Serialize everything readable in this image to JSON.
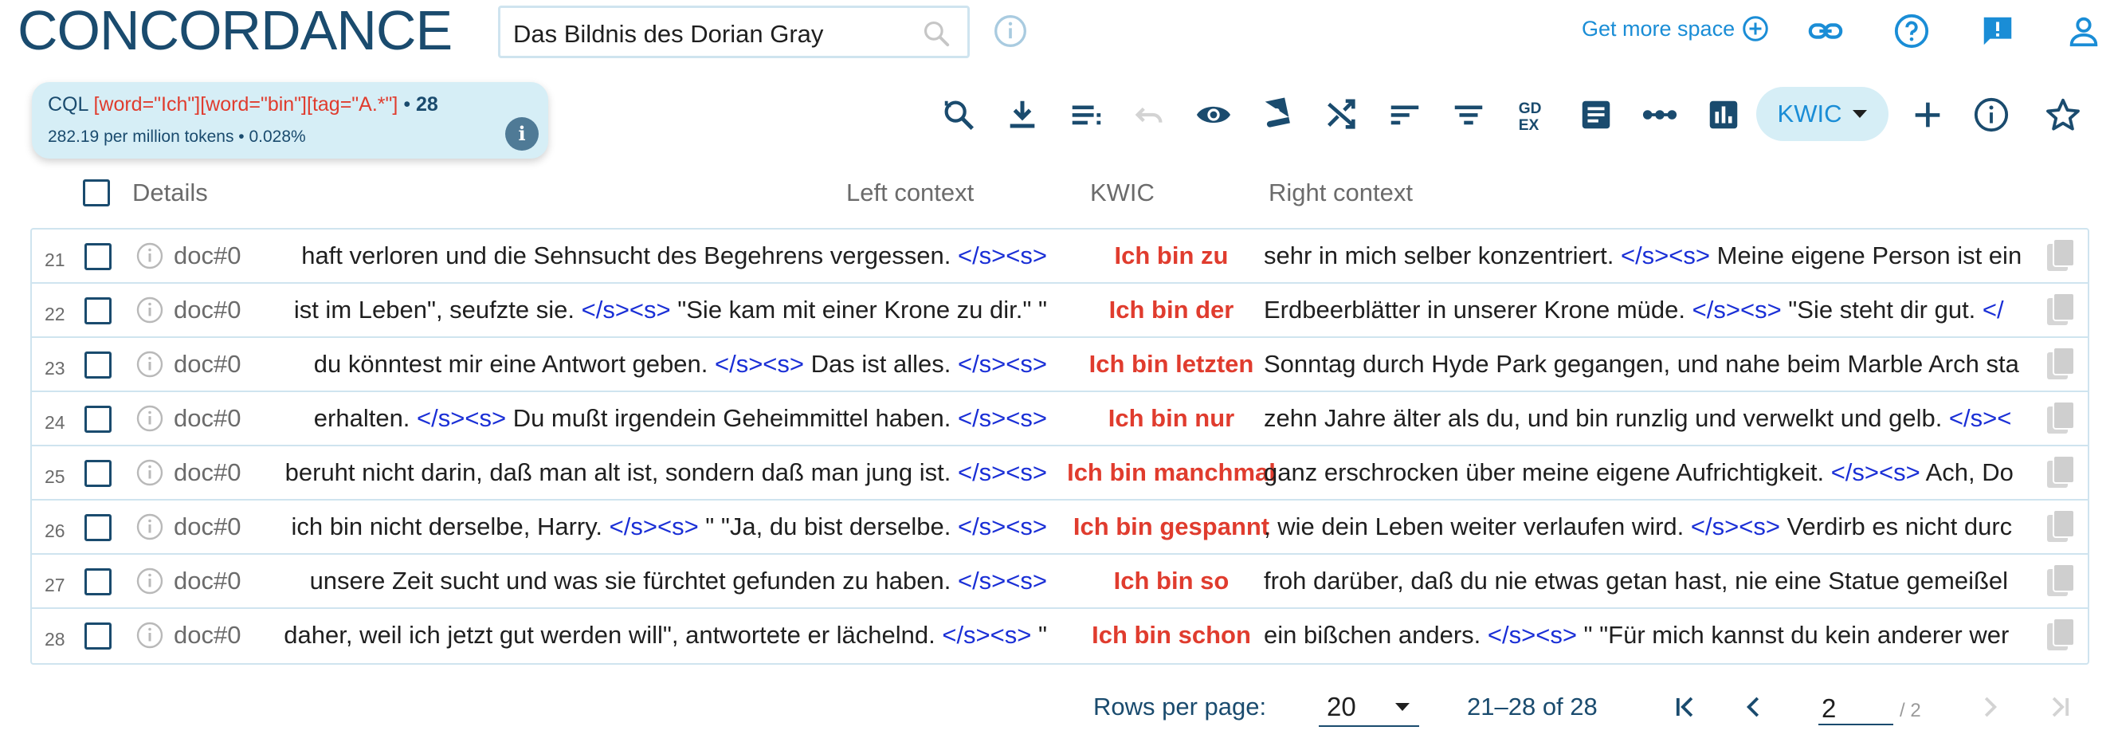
{
  "app": {
    "title": "CONCORDANCE"
  },
  "search": {
    "value": "Das Bildnis des Dorian Gray"
  },
  "header": {
    "get_more_space": "Get more space"
  },
  "query": {
    "prefix": "CQL",
    "cql": "[word=\"Ich\"][word=\"bin\"][tag=\"A.*\"]",
    "bullet": "•",
    "count": "28",
    "stats": "282.19 per million tokens • 0.028%"
  },
  "view": {
    "mode": "KWIC"
  },
  "table": {
    "headers": {
      "details": "Details",
      "left": "Left context",
      "kwic": "KWIC",
      "right": "Right context"
    },
    "rows": [
      {
        "n": "21",
        "doc": "doc#0",
        "left": [
          "haft verloren und die Sehnsucht des Begehrens vergessen. ",
          "</s><s>"
        ],
        "kwic": "Ich bin zu",
        "right": [
          "sehr in mich selber konzentriert. ",
          "</s><s>",
          " Meine eigene Person ist ein"
        ]
      },
      {
        "n": "22",
        "doc": "doc#0",
        "left": [
          "ist im Leben\", seufzte sie. ",
          "</s><s>",
          " \"Sie kam mit einer Krone zu dir.\" \""
        ],
        "kwic": "Ich bin der",
        "right": [
          "Erdbeerblätter in unserer Krone müde. ",
          "</s><s>",
          " \"Sie steht dir gut. ",
          "</"
        ]
      },
      {
        "n": "23",
        "doc": "doc#0",
        "left": [
          "du könntest mir eine Antwort geben. ",
          "</s><s>",
          " Das ist alles. ",
          "</s><s>"
        ],
        "kwic": "Ich bin letzten",
        "right": [
          "Sonntag durch Hyde Park gegangen, und nahe beim Marble Arch sta"
        ]
      },
      {
        "n": "24",
        "doc": "doc#0",
        "left": [
          "erhalten. ",
          "</s><s>",
          " Du mußt irgendein Geheimmittel haben. ",
          "</s><s>"
        ],
        "kwic": "Ich bin nur",
        "right": [
          "zehn Jahre älter als du, und bin runzlig und verwelkt und gelb. ",
          "</s><"
        ]
      },
      {
        "n": "25",
        "doc": "doc#0",
        "left": [
          "beruht nicht darin, daß man alt ist, sondern daß man jung ist. ",
          "</s><s>"
        ],
        "kwic": "Ich bin manchmal",
        "right": [
          "ganz erschrocken über meine eigene Aufrichtigkeit. ",
          "</s><s>",
          " Ach, Do"
        ]
      },
      {
        "n": "26",
        "doc": "doc#0",
        "left": [
          "ich bin nicht derselbe, Harry. ",
          "</s><s>",
          " \" \"Ja, du bist derselbe. ",
          "</s><s>"
        ],
        "kwic": "Ich bin gespannt",
        "right": [
          ", wie dein Leben weiter verlaufen wird. ",
          "</s><s>",
          " Verdirb es nicht durc"
        ]
      },
      {
        "n": "27",
        "doc": "doc#0",
        "left": [
          "unsere Zeit sucht und was sie fürchtet gefunden zu haben. ",
          "</s><s>"
        ],
        "kwic": "Ich bin so",
        "right": [
          "froh darüber, daß du nie etwas getan hast, nie eine Statue gemeißel"
        ]
      },
      {
        "n": "28",
        "doc": "doc#0",
        "left": [
          "daher, weil ich jetzt gut werden will\", antwortete er lächelnd. ",
          "</s><s>",
          " \""
        ],
        "kwic": "Ich bin schon",
        "right": [
          "ein bißchen anders. ",
          "</s><s>",
          " \" \"Für mich kannst du kein anderer wer"
        ]
      }
    ]
  },
  "footer": {
    "rows_per_page_label": "Rows per page:",
    "rows_per_page": "20",
    "range": "21–28 of 28",
    "page": "2",
    "page_total": "/ 2"
  },
  "colors": {
    "brand": "#1a4b6e",
    "accent": "#1a8dd6",
    "kwic": "#e03c2e",
    "tag": "#1a2fd6",
    "chip": "#d6eef6"
  },
  "icons": {
    "header": [
      "search-icon",
      "info-icon",
      "add-circle-icon",
      "link-icon",
      "help-icon",
      "feedback-icon",
      "account-icon"
    ],
    "toolbar": [
      "search-history-icon",
      "download-icon",
      "list-icon",
      "undo-icon",
      "eye-icon",
      "book-icon",
      "shuffle-icon",
      "sort-icon",
      "filter-icon",
      "gdex-icon",
      "document-icon",
      "collocations-icon",
      "chart-icon",
      "plus-icon",
      "info-icon",
      "star-icon"
    ]
  }
}
